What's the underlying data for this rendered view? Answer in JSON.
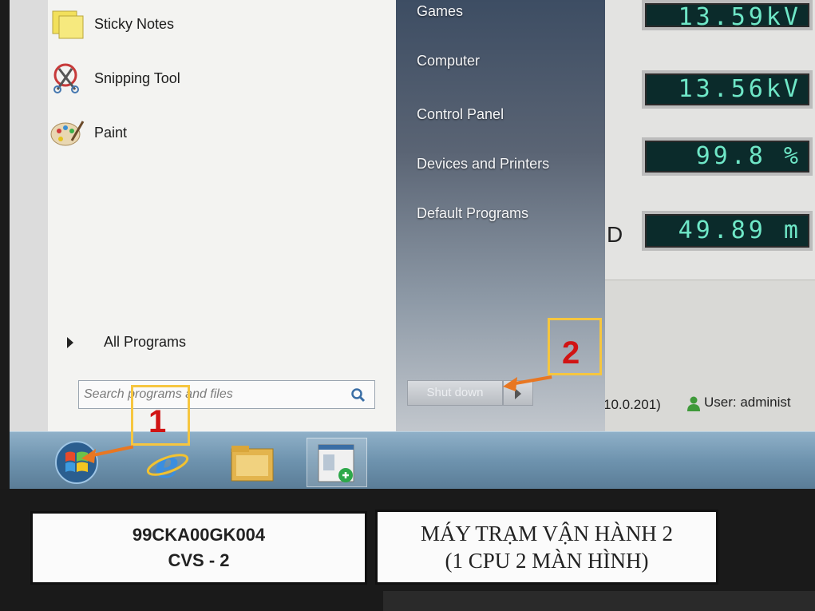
{
  "start_menu": {
    "programs": [
      {
        "label": "Sticky Notes",
        "icon": "sticky-notes-icon"
      },
      {
        "label": "Snipping Tool",
        "icon": "scissors-icon"
      },
      {
        "label": "Paint",
        "icon": "palette-icon"
      }
    ],
    "all_programs": "All Programs",
    "search_placeholder": "Search programs and files",
    "right_items": [
      "Games",
      "Computer",
      "Control Panel",
      "Devices and Printers",
      "Default Programs"
    ],
    "shutdown_label": "Shut down"
  },
  "app": {
    "readouts": [
      "13.59kV",
      "13.56kV",
      "99.8 %",
      "49.89 m"
    ],
    "label_fragment": "D",
    "status_ip": "10.0.201)",
    "status_user": "User:  administ"
  },
  "taskbar": {
    "items": [
      "start-orb-icon",
      "internet-explorer-icon",
      "folder-icon",
      "application-icon"
    ]
  },
  "annotations": {
    "marker_1": "1",
    "marker_2": "2",
    "accent": "#f6c63f",
    "arrow_color": "#e87722",
    "number_color": "#d11414"
  },
  "labels": {
    "tag_code": "99CKA00GK004",
    "tag_name": "CVS - 2",
    "station_line1": "MÁY TRẠM VẬN HÀNH 2",
    "station_line2": "(1 CPU 2 MÀN HÌNH)"
  }
}
